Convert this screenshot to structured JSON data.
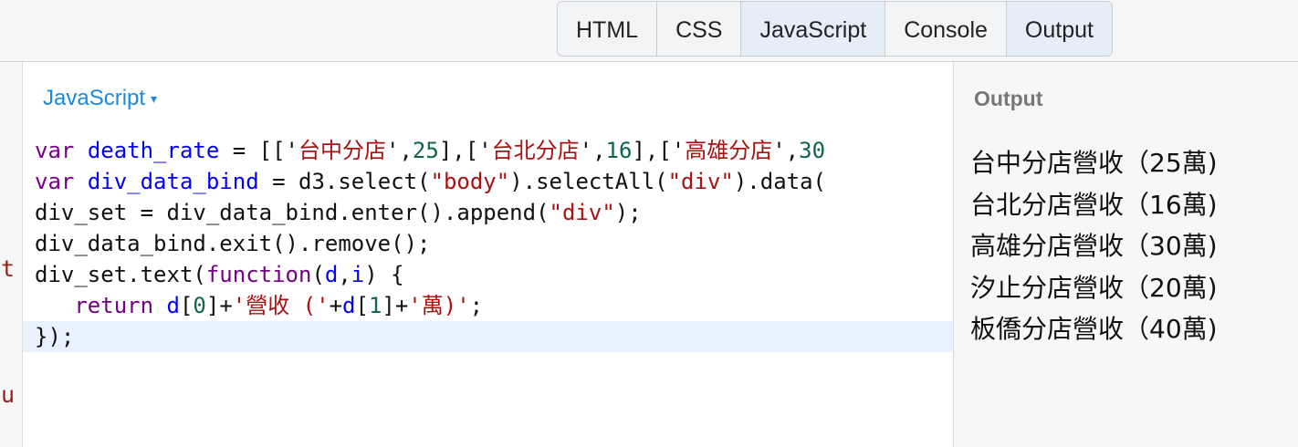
{
  "tabs": [
    {
      "label": "HTML",
      "active": false
    },
    {
      "label": "CSS",
      "active": false
    },
    {
      "label": "JavaScript",
      "active": true
    },
    {
      "label": "Console",
      "active": false
    },
    {
      "label": "Output",
      "active": true
    }
  ],
  "left_strip": {
    "frag1": "nt",
    "frag2": "ou"
  },
  "js_panel": {
    "label": "JavaScript",
    "caret": "▾"
  },
  "code": {
    "l1": [
      "var",
      " ",
      "death_rate",
      " = [['",
      "台中分店",
      "',",
      "25",
      "],['",
      "台北分店",
      "',",
      "16",
      "],['",
      "高雄分店",
      "',",
      "30"
    ],
    "l2": [
      "var",
      " ",
      "div_data_bind",
      " = d3.select(",
      "\"body\"",
      ").selectAll(",
      "\"div\"",
      ").data("
    ],
    "l3": [
      "div_set = div_data_bind.enter().append(",
      "\"div\"",
      ");"
    ],
    "l4": [
      "div_data_bind.exit().remove();"
    ],
    "l5": [
      "div_set.text(",
      "function",
      "(",
      "d",
      ",",
      "i",
      ") {"
    ],
    "l6": [
      "   ",
      "return",
      " ",
      "d",
      "[",
      "0",
      "]+",
      "'營收 ('",
      "+",
      "d",
      "[",
      "1",
      "]+",
      "'萬)'",
      ";"
    ],
    "l7": [
      "});"
    ]
  },
  "output_panel": {
    "label": "Output",
    "items": [
      "台中分店營收（25萬)",
      "台北分店營收（16萬)",
      "高雄分店營收（30萬)",
      "汐止分店營收（20萬)",
      "板僑分店營收（40萬)"
    ]
  },
  "colors": {
    "keyword": "#770088",
    "variable_def": "#0000ff",
    "string": "#aa1111",
    "number": "#116644",
    "accent": "#1a8ae0"
  }
}
